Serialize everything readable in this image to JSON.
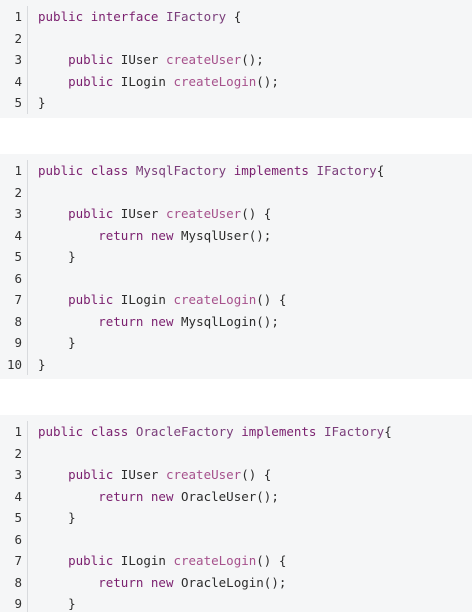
{
  "blocks": [
    {
      "name": "iface-block",
      "lines": [
        {
          "n": "1",
          "tokens": [
            [
              "kw",
              "public "
            ],
            [
              "kw",
              "interface "
            ],
            [
              "ty",
              "IFactory"
            ],
            [
              "pl",
              " {"
            ]
          ]
        },
        {
          "n": "2",
          "tokens": []
        },
        {
          "n": "3",
          "tokens": [
            [
              "pl",
              "    "
            ],
            [
              "kw",
              "public "
            ],
            [
              "pl",
              "IUser "
            ],
            [
              "fn",
              "createUser"
            ],
            [
              "pl",
              "();"
            ]
          ]
        },
        {
          "n": "4",
          "tokens": [
            [
              "pl",
              "    "
            ],
            [
              "kw",
              "public "
            ],
            [
              "pl",
              "ILogin "
            ],
            [
              "fn",
              "createLogin"
            ],
            [
              "pl",
              "();"
            ]
          ]
        },
        {
          "n": "5",
          "tokens": [
            [
              "pl",
              "}"
            ]
          ]
        }
      ]
    },
    {
      "name": "mysql-block",
      "lines": [
        {
          "n": "1",
          "tokens": [
            [
              "kw",
              "public "
            ],
            [
              "kw",
              "class "
            ],
            [
              "ty",
              "MysqlFactory "
            ],
            [
              "kw",
              "implements "
            ],
            [
              "ty",
              "IFactory"
            ],
            [
              "pl",
              "{"
            ]
          ]
        },
        {
          "n": "2",
          "tokens": []
        },
        {
          "n": "3",
          "tokens": [
            [
              "pl",
              "    "
            ],
            [
              "kw",
              "public "
            ],
            [
              "pl",
              "IUser "
            ],
            [
              "fn",
              "createUser"
            ],
            [
              "pl",
              "() {"
            ]
          ]
        },
        {
          "n": "4",
          "tokens": [
            [
              "pl",
              "        "
            ],
            [
              "kw",
              "return "
            ],
            [
              "kw",
              "new "
            ],
            [
              "pl",
              "MysqlUser();"
            ]
          ]
        },
        {
          "n": "5",
          "tokens": [
            [
              "pl",
              "    }"
            ]
          ]
        },
        {
          "n": "6",
          "tokens": []
        },
        {
          "n": "7",
          "tokens": [
            [
              "pl",
              "    "
            ],
            [
              "kw",
              "public "
            ],
            [
              "pl",
              "ILogin "
            ],
            [
              "fn",
              "createLogin"
            ],
            [
              "pl",
              "() {"
            ]
          ]
        },
        {
          "n": "8",
          "tokens": [
            [
              "pl",
              "        "
            ],
            [
              "kw",
              "return "
            ],
            [
              "kw",
              "new "
            ],
            [
              "pl",
              "MysqlLogin();"
            ]
          ]
        },
        {
          "n": "9",
          "tokens": [
            [
              "pl",
              "    }"
            ]
          ]
        },
        {
          "n": "10",
          "tokens": [
            [
              "pl",
              "}"
            ]
          ]
        }
      ]
    },
    {
      "name": "oracle-block",
      "lines": [
        {
          "n": "1",
          "tokens": [
            [
              "kw",
              "public "
            ],
            [
              "kw",
              "class "
            ],
            [
              "ty",
              "OracleFactory "
            ],
            [
              "kw",
              "implements "
            ],
            [
              "ty",
              "IFactory"
            ],
            [
              "pl",
              "{"
            ]
          ]
        },
        {
          "n": "2",
          "tokens": []
        },
        {
          "n": "3",
          "tokens": [
            [
              "pl",
              "    "
            ],
            [
              "kw",
              "public "
            ],
            [
              "pl",
              "IUser "
            ],
            [
              "fn",
              "createUser"
            ],
            [
              "pl",
              "() {"
            ]
          ]
        },
        {
          "n": "4",
          "tokens": [
            [
              "pl",
              "        "
            ],
            [
              "kw",
              "return "
            ],
            [
              "kw",
              "new "
            ],
            [
              "pl",
              "OracleUser();"
            ]
          ]
        },
        {
          "n": "5",
          "tokens": [
            [
              "pl",
              "    }"
            ]
          ]
        },
        {
          "n": "6",
          "tokens": []
        },
        {
          "n": "7",
          "tokens": [
            [
              "pl",
              "    "
            ],
            [
              "kw",
              "public "
            ],
            [
              "pl",
              "ILogin "
            ],
            [
              "fn",
              "createLogin"
            ],
            [
              "pl",
              "() {"
            ]
          ]
        },
        {
          "n": "8",
          "tokens": [
            [
              "pl",
              "        "
            ],
            [
              "kw",
              "return "
            ],
            [
              "kw",
              "new "
            ],
            [
              "pl",
              "OracleLogin();"
            ]
          ]
        },
        {
          "n": "9",
          "tokens": [
            [
              "pl",
              "    }"
            ]
          ]
        }
      ]
    }
  ]
}
